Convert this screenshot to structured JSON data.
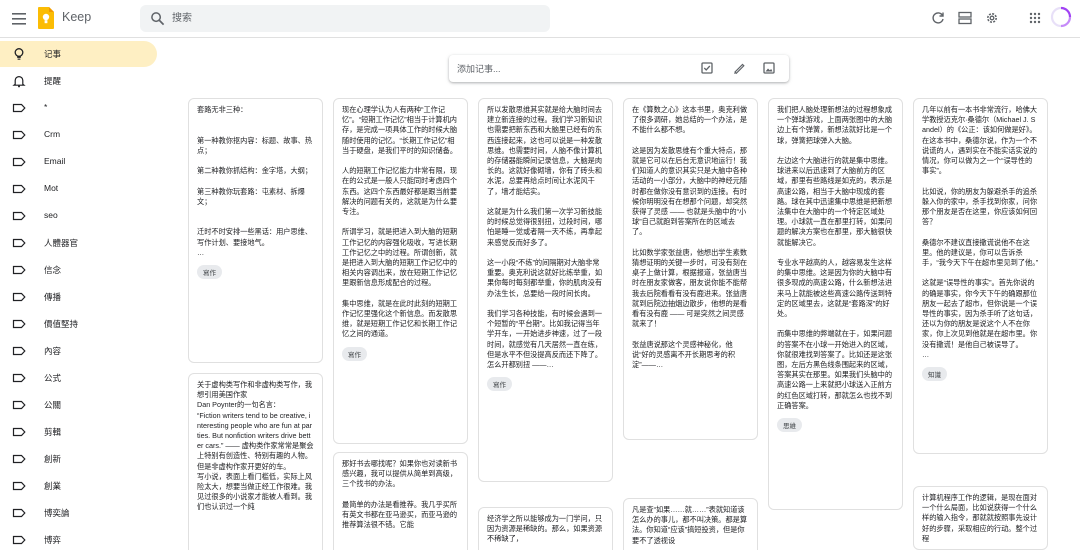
{
  "header": {
    "app_name": "Keep",
    "search_placeholder": "搜索",
    "icons": [
      "menu-icon",
      "keep-logo",
      "search-icon",
      "refresh-icon",
      "list-view-icon",
      "settings-icon",
      "apps-grid-icon",
      "profile-avatar"
    ]
  },
  "colors": {
    "active_nav": "#feefc3",
    "logo_yellow": "#fbbc04",
    "search_bg": "#f1f3f4",
    "chip_bg": "#e8eaed",
    "note_border": "#e0e0e0"
  },
  "sidebar": {
    "items": [
      {
        "label": "记事",
        "icon": "lightbulb-icon",
        "active": true
      },
      {
        "label": "提醒",
        "icon": "bell-icon"
      },
      {
        "label": "*",
        "icon": "label-icon"
      },
      {
        "label": "Crm",
        "icon": "label-icon"
      },
      {
        "label": "Email",
        "icon": "label-icon"
      },
      {
        "label": "Mot",
        "icon": "label-icon"
      },
      {
        "label": "seo",
        "icon": "label-icon"
      },
      {
        "label": "人體器官",
        "icon": "label-icon"
      },
      {
        "label": "信念",
        "icon": "label-icon"
      },
      {
        "label": "傳播",
        "icon": "label-icon"
      },
      {
        "label": "價值堅持",
        "icon": "label-icon"
      },
      {
        "label": "內容",
        "icon": "label-icon"
      },
      {
        "label": "公式",
        "icon": "label-icon"
      },
      {
        "label": "公關",
        "icon": "label-icon"
      },
      {
        "label": "剪輯",
        "icon": "label-icon"
      },
      {
        "label": "創新",
        "icon": "label-icon"
      },
      {
        "label": "創業",
        "icon": "label-icon"
      },
      {
        "label": "博奕論",
        "icon": "label-icon"
      },
      {
        "label": "博弈",
        "icon": "label-icon"
      }
    ]
  },
  "take_note": {
    "placeholder": "添加记事...",
    "icons": [
      "checkbox-icon",
      "brush-icon",
      "image-icon"
    ]
  },
  "notes": [
    {
      "text": "套路无非三种：\n\n\n第一种教你抠内容：标题、故事、热点；\n\n第二种教你抓结构：金字塔，大纲；\n\n第三种教你玩套路：屯素材、拆爆文；\n\n\n迁时不时安排一些黑话：用户思维、写作计划、要接地气。\n…",
      "label": "寫作"
    },
    {
      "text": "关于虚构类写作和非虚构类写作，我想引用美国作家\nDan Poynter的一句名言：\n“Fiction writers tend to be creative, interesting people who are fun at parties. But nonfiction writers drive better cars.” —— 虚构类作家常常是聚会上特别有创造性、特别有趣的人物。但是非虚构作家开更好的车。\n写小说，表面上看门槛低，实际上风险太大，想要当做正经工作很难。我见过很多的小说家才能被人看到。我们也认识过一个纯"
    },
    {
      "text": "现在心理学认为人有两种“工作记忆”。“短期工作记忆”相当于计算机内存，是完成一项具体工作的时候大脑随时使用的记忆。“长期工作记忆”相当于硬盘，是我们平时的知识储备。\n\n人的短期工作记忆能力非常有限，现在的公式是一般人只能同时考虑四个东西。这四个东西最好都是跟当前要解决的问题有关的，这就是为什么要专注。\n\n所谓学习，就是把进入到大脑的短期工作记忆的内容强化吸收，写进长期工作记忆之中的过程。所谓创新，就是把进入到大脑的短期工作记忆中的相关内容调出来，放在短期工作记忆里跟新信息形成配合的过程。\n\n集中思维，就是在此时此刻的短期工作记忆里强化这个新信息。而发散思维，就是短期工作记忆和长期工作记忆之间的通道。",
      "label": "寫作"
    },
    {
      "text": "那好书去哪找呢？如果你也对读新书感兴趣，我可以提供从简单到高级，三个找书的办法。\n\n最简单的办法是看推荐。我几乎买所有英文书都在亚马逊买，而亚马逊的推荐算法很不错。它能"
    },
    {
      "text": "所以发散思维其实就是给大脑时间去建立新连接的过程。我们学习新知识也需要把新东西和大脑里已经有的东西连接起来，这也可以说是一种发散思维。也需要时间，人脑不像计算机的存储器能瞬间记录信息，大脑是肉长的。这就好像砌墙，你有了砖头和水泥，总要再给点时间让水泥风干了，墙才能结实。\n\n这就是为什么我们第一次学习新技能的时候总觉得很别扭，过段时间，哪怕是睡一觉或者隔一天不练，再拿起来感觉反而好多了。\n\n这一小段“不练”的间隔期对大脑非常重要。奥克利说这就好比练举重，如果你每时每刻都举重，你的肌肉没有办法生长，总要给一段时间长肉。\n\n我们学习各种技能，有时候会遇到一个短暂的“平台期”。比如我记得当年学开车，一开始进步神速，过了一段时间，就感觉有几天居然一直在练，但是水平不但没提高反而还下降了。怎么开都别扭 ——…",
      "label": "寫作"
    },
    {
      "text": "经济学之所以能够成为一门学问，只因为资源是稀缺的。那么，如果资源不稀缺了，"
    },
    {
      "text": "在《算数之心》这本书里，奥克利做了很多调研，她总结的一个办法，是不能什么都不想。\n\n这是因为发散思维有个重大特点，那就是它可以在后台无意识地运行！我们知道人的意识其实只是大脑中各种活动的一小部分，大脑中的神经元随时都在做你没有意识到的连接。有时候你明明没有在想那个问题，却突然获得了灵感 —— 也就是头脑中的“小球”自己就跑到答案所在的区域去了。\n\n比如数学家张益唐，他想出学生素数猜想证明的关键一步时，可没有刻在桌子上做计算，根据报道，张益唐当时在朋友家做客，朋友说你能不能帮我去后院看看有没有鹿进来。张益唐就到后院边抽烟边散步，他想的是看看有没有鹿 —— 可是突然之间灵感就来了！\n\n张益唐说那这个灵感神秘化，他说“好的灵感离不开长期思考的积淀”——…"
    },
    {
      "text": "凡是查“如果……就……”表就知道该怎么办的事儿，都不叫决策。都是算法。你知道“应该”搞短投资，但是你要不了透视设"
    },
    {
      "text": "我们把人脑处理新想法的过程想象成一个弹球游戏，上面两张图中的大脑边上有个弹簧，新想法就好比是一个球，弹簧把球弹入大脑。\n\n左边这个大脑进行的就是集中思维。球进来以后迅速到了大脑前方的区域，那里有些路线是如克的，表示是高速公路，相当于大脑中现成的套路。球在其中迅速集中思维是把新想法集中在大脑中的一个特定区域处理。小球就一直在那里打转，如果问题的解决方案也在那里，那大脑很快就能解决它。\n\n专业水平越高的人，越容易发生这样的集中思维。这是因为你的大脑中有很多现成的高速公路，什么新想法进来马上就能被这些高速公路传送到特定的区域里去，这就是“套路深”的好处。\n\n而集中思维的弊端就在于，如果问题的答案不在小球一开始进入的区域，你就很难找到答案了。比如还是这张图，左后方黑色线条围起来的区域，答案其实在那里。如果我们头脑中的高速公路一上来就把小球送入正前方的红色区域打转，那就怎么也找不到正确答案。",
      "label": "思維"
    },
    {
      "text": "几年以前有一本书非常流行，哈佛大学教授迈克尔·桑德尔（Michael J. Sandel）的《公正：该如何做是好》。在这本书中，桑德尔说，作为一个不说谎的人，遇到实在不能实话实说的情况，你可以做为之一个“误导性的事实”。\n\n比如说，你的朋友为躲避杀手的追杀躲入你的家中，杀手找到你家，问你那个朋友是否在这里，你应该如何回答？\n\n桑德尔不建议直接撒谎说他不在这里。他的建议是，你可以告诉杀手，“我今天下午在超市里见到了他。”\n\n这就是“误导性的事实”。首先你说的的确是事实，你今天下午的确跟那位朋友一起去了超市，但你说是一个误导性的事实，因为杀手听了这句话，还以为你的朋友是说这个人不在你家，你上次见到他就是在超市里。你没有撒谎！是他自己被误导了。\n…",
      "label": "知識"
    },
    {
      "text": "计算机程序工作的逻辑，是现在面对一个什么局面，比如说获得一个什么样的输入指令，那就就按照事先设计好的步骤，采取相应的行动。整个过程"
    }
  ]
}
